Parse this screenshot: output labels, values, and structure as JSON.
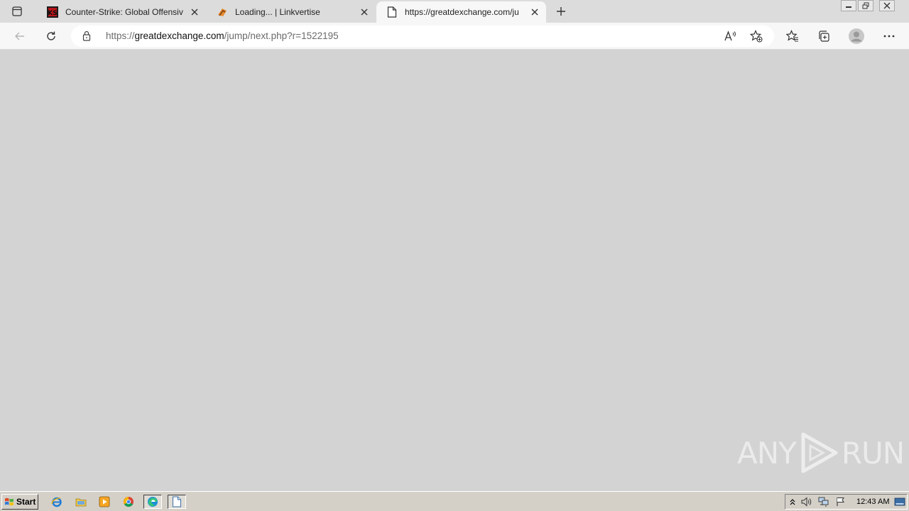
{
  "browser": {
    "tabs": [
      {
        "title": "Counter-Strike: Global Offensiv",
        "favicon": "cs-logo-icon",
        "active": false
      },
      {
        "title": "Loading... | Linkvertise",
        "favicon": "linkvertise-icon",
        "active": false
      },
      {
        "title": "https://greatdexchange.com/ju",
        "favicon": "page-icon",
        "active": true
      }
    ],
    "url_prefix": "https://",
    "url_host": "greatdexchange.com",
    "url_path": "/jump/next.php?r=1522195",
    "read_aloud_label": "A⁾"
  },
  "watermark": {
    "left": "ANY",
    "right": "RUN"
  },
  "taskbar": {
    "start_label": "Start",
    "clock": "12:43 AM",
    "quick_launch": [
      "ie-icon",
      "folder-icon",
      "media-player-icon",
      "chrome-icon",
      "edge-icon",
      "blank-document-icon"
    ]
  },
  "colors": {
    "page_bg": "#d3d3d3",
    "tab_active": "#f7f7f7",
    "taskbar": "#d4d0c8"
  }
}
